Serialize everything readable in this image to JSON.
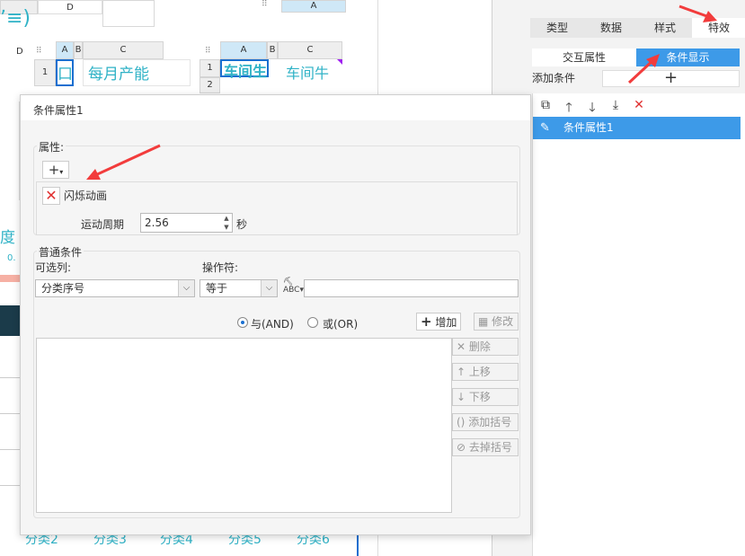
{
  "canvas": {
    "col_a": "A",
    "col_b": "B",
    "col_c": "C",
    "col_d": "D",
    "row_1": "1",
    "row_2": "2",
    "text_monthly": "每月产能",
    "text_workshop": "车间生",
    "text_workshop2": "车间牛",
    "text_du": "度",
    "text_small": "0.",
    "axis_labels": [
      "分类2",
      "分类3",
      "分类4",
      "分类5",
      "分类6"
    ]
  },
  "right_panel": {
    "tabs": [
      "类型",
      "数据",
      "样式",
      "特效"
    ],
    "active_tab": "特效",
    "subtab_interactive": "交互属性",
    "subtab_condition": "条件显示",
    "add_condition_label": "添加条件",
    "add_icon": "plus-icon",
    "list_item": "条件属性1"
  },
  "dialog": {
    "title": "条件属性1",
    "property_label": "属性:",
    "add_prop_label": "+",
    "effect_name": "闪烁动画",
    "period_label": "运动周期",
    "period_value": "2.56",
    "period_unit": "秒",
    "normal_condition_label": "普通条件",
    "column_label": "可选列:",
    "operator_label": "操作符:",
    "column_value": "分类序号",
    "operator_value": "等于",
    "and_label": "与(AND)",
    "or_label": "或(OR)",
    "add_btn": "增加",
    "modify_btn": "修改",
    "delete_btn": "删除",
    "up_btn": "上移",
    "down_btn": "下移",
    "add_bracket_btn": "添加括号",
    "remove_bracket_btn": "去掉括号"
  },
  "colors": {
    "accent_blue": "#3d9ae8",
    "teal_text": "#2fb2c6",
    "arrow_red": "#f23c3c"
  }
}
